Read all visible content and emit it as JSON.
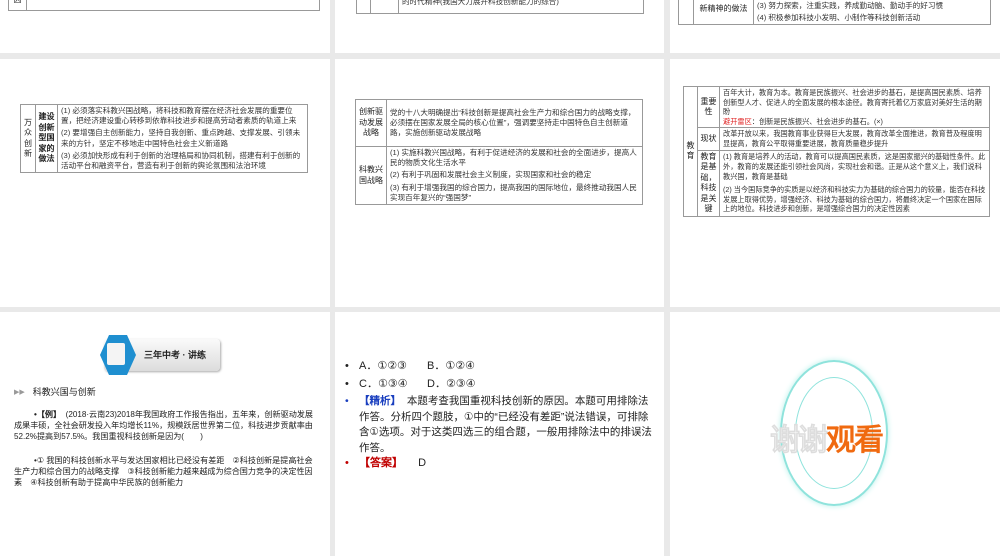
{
  "slides": {
    "s1": {
      "cell": "因"
    },
    "s2": {
      "cell": "的时代精神(我国大力展开科技创新能力的综合)"
    },
    "s3": {
      "label": "新精神的做法",
      "items": [
        "(3) 努力探索，注重实践，养成勤动脑、勤动手的好习惯",
        "(4) 积极参加科技小发明、小制作等科技创新活动"
      ]
    },
    "s4": {
      "col1": "万众创新",
      "col2": "建设创新型国家的做法",
      "items": [
        "(1) 必须落实科教兴国战略，将科技和教育摆在经济社会发展的重要位置，把经济建设重心转移到依靠科技进步和提高劳动者素质的轨道上来",
        "(2) 要增强自主创新能力，坚持自我创新、重点跨越、支撑发展、引领未来的方针，坚定不移地走中国特色社会主义新道路",
        "(3) 必须加快形成有利于创新的治理格局和协同机制，搭建有利于创新的活动平台和融资平台，营造有利于创新的舆论氛围和法治环境"
      ]
    },
    "s5": {
      "rows": [
        {
          "head": "创新驱动发展战略",
          "items": [
            "党的十八大明确提出“科技创新是提高社会生产力和综合国力的战略支撑，必须摆在国家发展全局的核心位置”，强调要坚持走中国特色自主创新道路，实施创新驱动发展战略"
          ]
        },
        {
          "head": "科教兴国战略",
          "items": [
            "(1) 实施科教兴国战略，有利于促进经济的发展和社会的全面进步，提高人民的物质文化生活水平",
            "(2) 有利于巩固和发展社会主义制度，实现国家和社会的稳定",
            "(3) 有利于增强我国的综合国力，提高我国的国际地位，最终推动我国人民实现百年复兴的“强国梦”"
          ]
        }
      ]
    },
    "s6": {
      "col1": "教育",
      "rows": [
        {
          "head": "重要性",
          "text": "百年大计，教育为本。教育是民族振兴、社会进步的基石，是提高国民素质、培养创新型人才、促进人的全面发展的根本途径。教育寄托着亿万家庭对美好生活的期盼",
          "warn_label": "避开雷区",
          "warn_text": "：创新是民族振兴、社会进步的基石。(×)"
        },
        {
          "head": "现状",
          "text": "改革开放以来，我国教育事业获得巨大发展，教育改革全面推进，教育普及程度明显提高，教育公平取得重要进展，教育质量稳步提升"
        },
        {
          "head": "教育是基础，科技是关键",
          "items": [
            "(1) 教育是培养人的活动，教育可以提高国民素质，这是国家振兴的基础性条件。此外，教育的发展还能引领社会风尚，实现社会和谐。正是从这个意义上，我们说科教兴国，教育是基础",
            "(2) 当今国际竞争的实质是以经济和科技实力为基础的综合国力的较量，能否在科技发展上取得优势，增强经济、科技为基础的综合国力，将最终决定一个国家在国际上的地位。科技进步和创新，是增强综合国力的决定性因素"
          ]
        }
      ]
    },
    "s7": {
      "banner": "三年中考 · 讲练",
      "subheading": "科教兴国与创新",
      "example_label": "•【例】",
      "example": "(2018·云南23)2018年我国政府工作报告指出，五年来，创新驱动发展成果丰硕，全社会研发投入年均增长11%，规模跃居世界第二位，科技进步贡献率由52.2%提高到57.5%。我国重视科技创新是因为(　　)",
      "statements": "•① 我国的科技创新水平与发达国家相比已经没有差距　②科技创新是提高社会生产力和综合国力的战略支撑　③科技创新能力越来越成为综合国力竞争的决定性因素　④科技创新有助于提高中华民族的创新能力"
    },
    "s8": {
      "opt_a": "A．①②③",
      "opt_b": "B．①②④",
      "opt_c": "C．①③④",
      "opt_d": "D．②③④",
      "analysis_label": "【精析】",
      "analysis": "本题考查我国重视科技创新的原因。本题可用排除法作答。分析四个题肢，①中的“已经没有差距”说法错误，可排除含①选项。对于这类四选三的组合题，一般用排除法中的排误法作答。",
      "answer_label": "【答案】",
      "answer": "D"
    },
    "s9": {
      "thanks_a": "谢谢",
      "thanks_b": "观看"
    }
  },
  "colors": {
    "accent_blue": "#1a3fbf",
    "answer_red": "#c00000",
    "thanks_orange": "#f06a10",
    "ring": "#7fded8"
  }
}
